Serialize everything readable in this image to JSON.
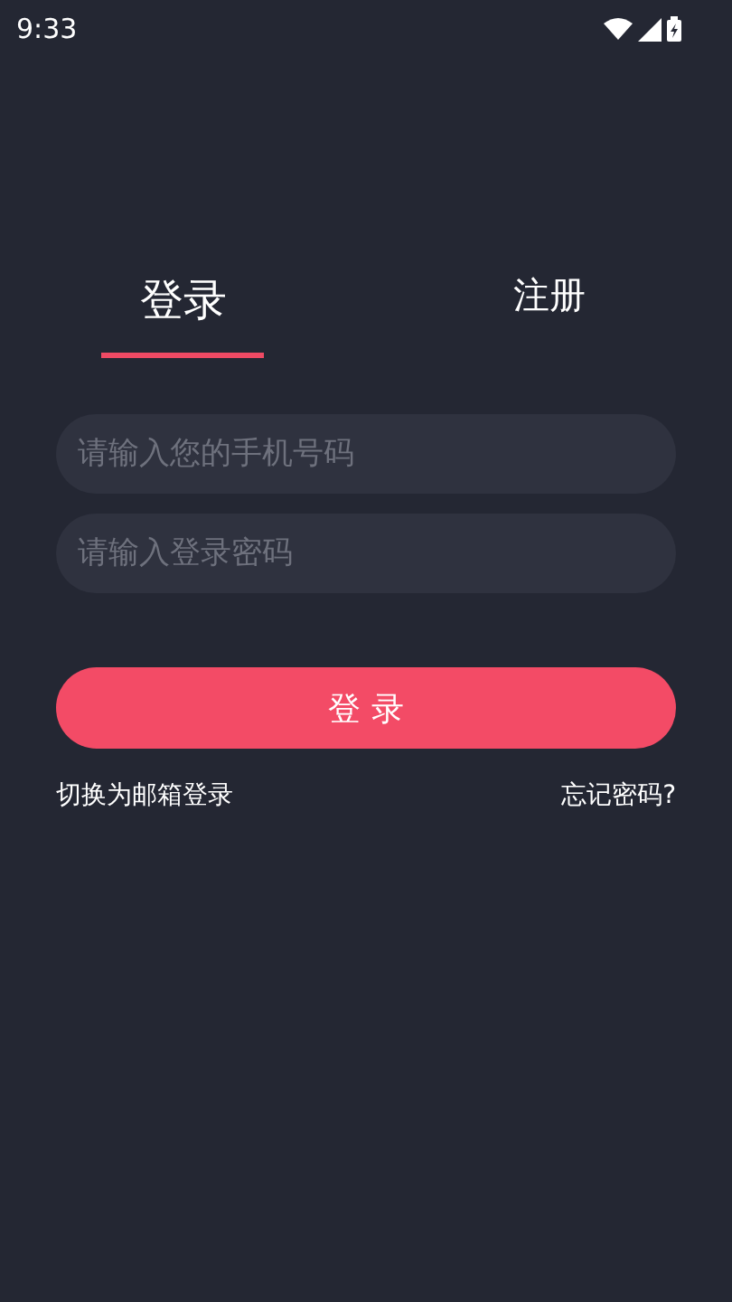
{
  "status_bar": {
    "time": "9:33"
  },
  "tabs": [
    {
      "label": "登录",
      "selected": true
    },
    {
      "label": "注册",
      "selected": false
    }
  ],
  "fields": [
    {
      "placeholder": "请输入您的手机号码"
    },
    {
      "placeholder": "请输入登录密码"
    }
  ],
  "login_button": "登 录",
  "links": {
    "switch": "切换为邮箱登录",
    "forgot": "忘记密码?"
  }
}
